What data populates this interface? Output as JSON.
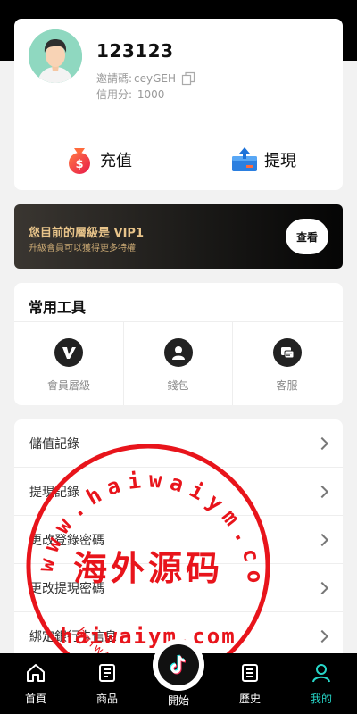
{
  "profile": {
    "username": "123123",
    "invite_label": "邀請碼:",
    "invite_code": "ceyGEH",
    "credit_label": "信用分:",
    "credit_value": "1000"
  },
  "actions": {
    "recharge_label": "充值",
    "withdraw_label": "提現"
  },
  "vip": {
    "title": "您目前的層級是 VIP1",
    "subtitle": "升級會員可以獲得更多特權",
    "view_button": "查看"
  },
  "tools": {
    "title": "常用工具",
    "items": [
      {
        "label": "會員層級",
        "icon": "vip-level-icon"
      },
      {
        "label": "錢包",
        "icon": "wallet-user-icon"
      },
      {
        "label": "客服",
        "icon": "customer-service-icon"
      }
    ]
  },
  "menu": {
    "items": [
      {
        "label": "儲值記錄"
      },
      {
        "label": "提現記錄"
      },
      {
        "label": "更改登錄密碼"
      },
      {
        "label": "更改提現密碼"
      },
      {
        "label": "綁定銀行卡信息"
      }
    ]
  },
  "nav": {
    "items": [
      {
        "label": "首頁",
        "icon": "home-icon"
      },
      {
        "label": "商品",
        "icon": "product-list-icon"
      },
      {
        "label": "開始",
        "icon": "tiktok-logo-icon"
      },
      {
        "label": "歷史",
        "icon": "history-list-icon"
      },
      {
        "label": "我的",
        "icon": "user-profile-icon",
        "active": true
      }
    ],
    "active_color": "#27d6c8"
  },
  "watermark": {
    "ring_text": "www.haiwaiym.com",
    "center_text": "海外源码",
    "bottom_text": "haiwaiym.com",
    "inner_text": "haiwaiym",
    "color": "#e8141b"
  }
}
